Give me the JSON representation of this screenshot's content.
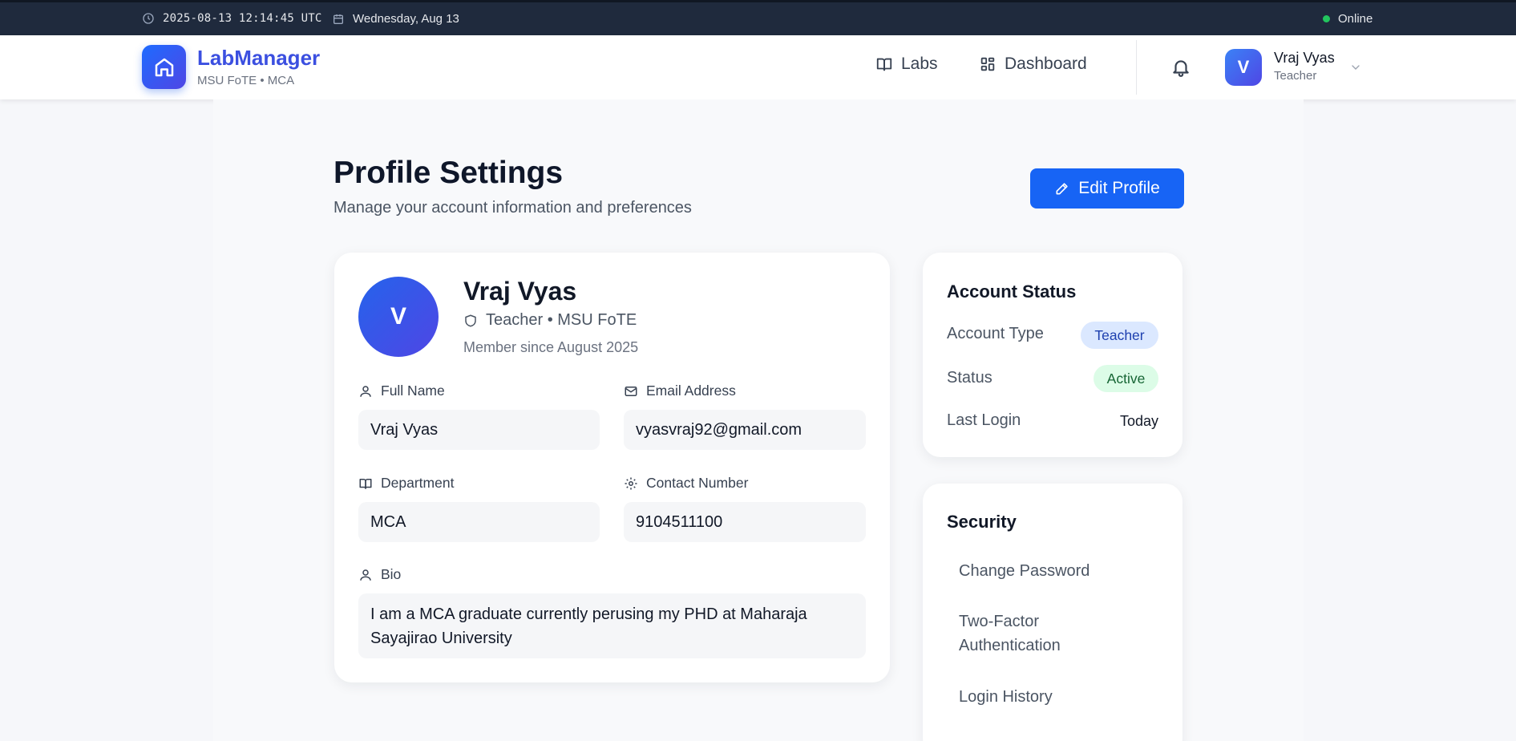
{
  "topbar": {
    "datetime": "2025-08-13 12:14:45 UTC",
    "date": "Wednesday, Aug 13",
    "status": "Online"
  },
  "header": {
    "brand": "LabManager",
    "brand_sub": "MSU FoTE • MCA",
    "nav": {
      "labs": "Labs",
      "dashboard": "Dashboard"
    },
    "user": {
      "initial": "V",
      "name": "Vraj Vyas",
      "role": "Teacher"
    }
  },
  "page": {
    "title": "Profile Settings",
    "subtitle": "Manage your account information and preferences",
    "edit_button": "Edit Profile"
  },
  "profile": {
    "initial": "V",
    "name": "Vraj Vyas",
    "role_line": "Teacher • MSU FoTE",
    "member_since": "Member since August 2025",
    "fields": {
      "full_name": {
        "label": "Full Name",
        "value": "Vraj Vyas"
      },
      "email": {
        "label": "Email Address",
        "value": "vyasvraj92@gmail.com"
      },
      "department": {
        "label": "Department",
        "value": "MCA"
      },
      "contact": {
        "label": "Contact Number",
        "value": "9104511100"
      },
      "bio": {
        "label": "Bio",
        "value": "I am a MCA graduate currently perusing my PHD at Maharaja Sayajirao University"
      }
    }
  },
  "account_status": {
    "title": "Account Status",
    "account_type_label": "Account Type",
    "account_type_value": "Teacher",
    "status_label": "Status",
    "status_value": "Active",
    "last_login_label": "Last Login",
    "last_login_value": "Today"
  },
  "security": {
    "title": "Security",
    "links": [
      "Change Password",
      "Two-Factor Authentication",
      "Login History"
    ]
  },
  "colors": {
    "accent": "#1764f5",
    "brand": "#3b4fe0",
    "topbar": "#1f2a3d",
    "online": "#22c55e"
  }
}
